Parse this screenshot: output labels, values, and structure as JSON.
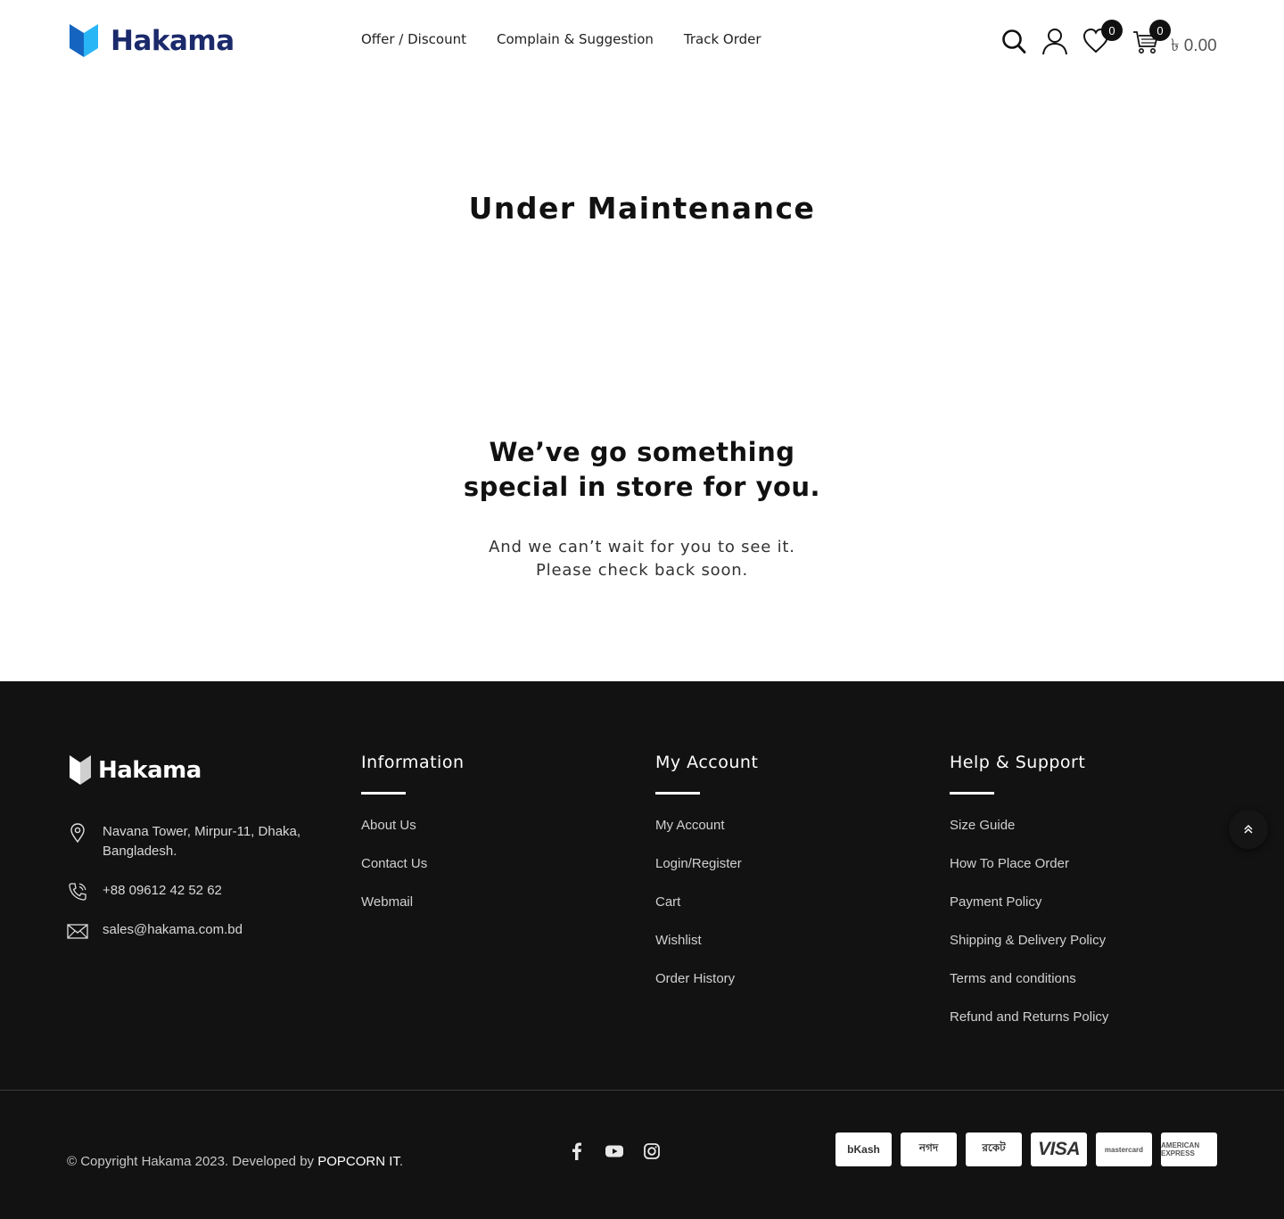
{
  "header": {
    "logo_text": "Hakama",
    "nav": [
      "Offer / Discount",
      "Complain & Suggestion",
      "Track Order"
    ],
    "wishlist_count": "0",
    "cart_count": "0",
    "cart_total": "৳ 0.00",
    "icons": [
      "search-icon",
      "user-icon",
      "heart-icon",
      "cart-icon"
    ]
  },
  "main": {
    "title": "Under Maintenance",
    "headline_line1": "We’ve go something",
    "headline_line2": "special in store for you.",
    "sub_line1": "And we can’t wait for you to see it.",
    "sub_line2": "Please check back soon."
  },
  "footer": {
    "logo_text": "Hakama",
    "address": "Navana Tower, Mirpur-11, Dhaka, Bangladesh.",
    "phone": "+88 09612 42 52 62",
    "email": "sales@hakama.com.bd",
    "columns": [
      {
        "title": "Information",
        "links": [
          "About Us",
          "Contact Us",
          "Webmail"
        ]
      },
      {
        "title": "My Account",
        "links": [
          "My Account",
          "Login/Register",
          "Cart",
          "Wishlist",
          "Order History"
        ]
      },
      {
        "title": "Help & Support",
        "links": [
          "Size Guide",
          "How To Place Order",
          "Payment Policy",
          "Shipping & Delivery Policy",
          "Terms and conditions",
          "Refund and Returns Policy"
        ]
      }
    ],
    "copyright_prefix": "© Copyright Hakama 2023. Developed by ",
    "copyright_brand": "POPCORN IT",
    "copyright_suffix": ".",
    "socials": [
      "facebook-icon",
      "youtube-icon",
      "instagram-icon"
    ],
    "payments": [
      "bKash",
      "নগদ",
      "রকেট",
      "VISA",
      "mastercard",
      "AMERICAN EXPRESS"
    ]
  },
  "colors": {
    "brand_navy": "#1b2a6b",
    "brand_blue": "#1e88e5",
    "footer_bg": "#121212"
  }
}
